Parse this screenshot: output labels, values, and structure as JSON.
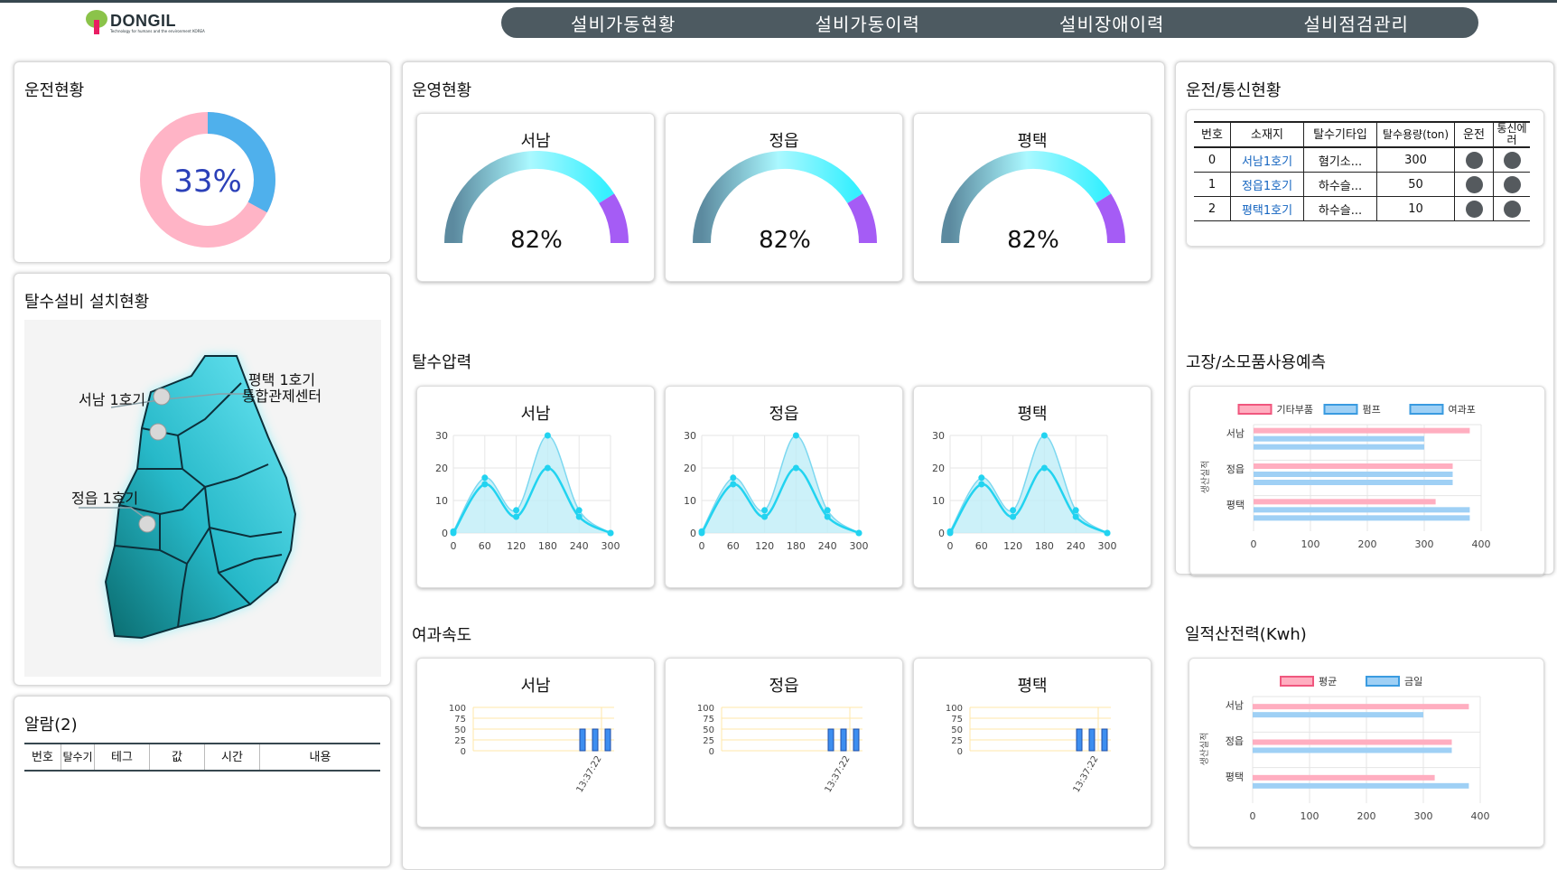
{
  "logo": {
    "brand": "DONGIL",
    "tagline": "Technology for humans and the environment  KOREA"
  },
  "nav": [
    "설비가동현황",
    "설비가동이력",
    "설비장애이력",
    "설비점검관리"
  ],
  "operation": {
    "title": "운전현황",
    "percent": 33,
    "percent_label": "33%",
    "colors": {
      "on": "#4fb0ec",
      "off": "#ffb4c6"
    }
  },
  "install": {
    "title": "탈수설비 설치현황",
    "labels": {
      "seonam": "서남 1호기",
      "pyeongtaek_line1": "평택 1호기",
      "pyeongtaek_line2": "통합관제센터",
      "jeongeup": "정읍 1호기"
    }
  },
  "alarm": {
    "title": "알람(2)",
    "columns": [
      "번호",
      "탈수기",
      "테그",
      "값",
      "시간",
      "내용"
    ]
  },
  "management": {
    "title": "운영현황",
    "gauges": [
      {
        "name": "서남",
        "percent": 82,
        "label": "82%"
      },
      {
        "name": "정읍",
        "percent": 82,
        "label": "82%"
      },
      {
        "name": "평택",
        "percent": 82,
        "label": "82%"
      }
    ]
  },
  "pressure": {
    "title": "탈수압력",
    "sites": [
      "서남",
      "정읍",
      "평택"
    ],
    "chart_data": {
      "type": "line",
      "x": [
        0,
        60,
        120,
        180,
        240,
        300
      ],
      "xticks": [
        "0",
        "60",
        "120",
        "180",
        "240",
        "300"
      ],
      "yticks": [
        "0",
        "10",
        "20",
        "30"
      ],
      "ylim": [
        0,
        30
      ],
      "xlim": [
        0,
        300
      ],
      "series": [
        {
          "values": [
            0.5,
            17,
            7,
            30,
            7,
            0
          ]
        },
        {
          "values": [
            0,
            15,
            5,
            20,
            5,
            0
          ]
        }
      ],
      "colors": [
        "#7dd8f0",
        "#22d3f0"
      ]
    }
  },
  "filtration": {
    "title": "여과속도",
    "sites": [
      "서남",
      "정읍",
      "평택"
    ],
    "chart_data": {
      "type": "bar",
      "categories": [
        "13:37:22"
      ],
      "yticks": [
        "0",
        "25",
        "50",
        "75",
        "100"
      ],
      "ylim": [
        0,
        100
      ],
      "values": [
        50,
        50,
        50
      ],
      "xlabel": "13:37:22"
    }
  },
  "comm": {
    "title": "운전/통신현황",
    "columns": [
      "번호",
      "소재지",
      "탈수기타입",
      "탈수용량(ton)",
      "운전",
      "통신에러"
    ],
    "rows": [
      {
        "no": "0",
        "site": "서남1호기",
        "type": "혐기소...",
        "capacity": "300"
      },
      {
        "no": "1",
        "site": "정읍1호기",
        "type": "하수슬...",
        "capacity": "50"
      },
      {
        "no": "2",
        "site": "평택1호기",
        "type": "하수슬...",
        "capacity": "10"
      }
    ]
  },
  "fault": {
    "title": "고장/소모품사용예측",
    "chart_data": {
      "type": "bar",
      "orientation": "horizontal",
      "categories": [
        "서남",
        "정읍",
        "평택"
      ],
      "ylabel": "생산실적",
      "xticks": [
        "0",
        "100",
        "200",
        "300",
        "400"
      ],
      "xlim": [
        0,
        400
      ],
      "series": [
        {
          "name": "기타부품",
          "values": [
            380,
            350,
            320
          ],
          "color": "#ffaec0"
        },
        {
          "name": "펌프",
          "values": [
            300,
            350,
            380
          ],
          "color": "#9fd0f5"
        },
        {
          "name": "여과포",
          "values": [
            300,
            350,
            380
          ],
          "color": "#9fd0f5"
        }
      ]
    }
  },
  "power": {
    "title": "일적산전력(Kwh)",
    "chart_data": {
      "type": "bar",
      "orientation": "horizontal",
      "categories": [
        "서남",
        "정읍",
        "평택"
      ],
      "ylabel": "생산실적",
      "xticks": [
        "0",
        "100",
        "200",
        "300",
        "400"
      ],
      "xlim": [
        0,
        400
      ],
      "series": [
        {
          "name": "평균",
          "values": [
            380,
            350,
            320
          ],
          "color": "#ffaec0"
        },
        {
          "name": "금일",
          "values": [
            300,
            350,
            380
          ],
          "color": "#9fd0f5"
        }
      ]
    }
  }
}
